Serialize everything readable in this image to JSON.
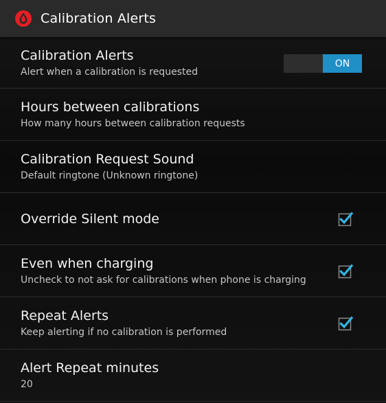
{
  "header": {
    "title": "Calibration Alerts",
    "icon": "blood-drop-icon",
    "accent": "#e51e25"
  },
  "preferences": [
    {
      "title": "Calibration Alerts",
      "summary": "Alert when a calibration is requested",
      "control": "toggle",
      "toggle_label": "ON"
    },
    {
      "title": "Hours between calibrations",
      "summary": "How many hours between calibration requests"
    },
    {
      "title": "Calibration Request Sound",
      "summary": "Default ringtone (Unknown ringtone)"
    },
    {
      "title": "Override Silent mode",
      "control": "checkbox",
      "checked": true
    },
    {
      "title": "Even when charging",
      "summary": "Uncheck to not ask for calibrations when phone is charging",
      "control": "checkbox",
      "checked": true
    },
    {
      "title": "Repeat Alerts",
      "summary": "Keep alerting if no calibration is performed",
      "control": "checkbox",
      "checked": true
    },
    {
      "title": "Alert Repeat minutes",
      "summary": "20"
    }
  ],
  "colors": {
    "toggle_on": "#1f8fc6",
    "checkmark": "#33b5e5"
  }
}
